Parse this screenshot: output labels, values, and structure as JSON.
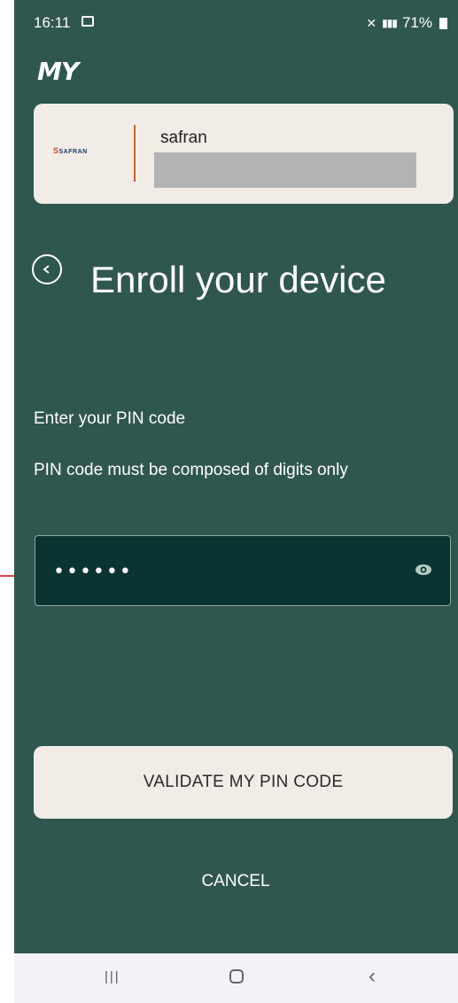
{
  "status_bar": {
    "time": "16:11",
    "battery": "71%"
  },
  "app": {
    "logo": "MY"
  },
  "org_card": {
    "org_logo_text": "SAFRAN",
    "org_name": "safran"
  },
  "page": {
    "title": "Enroll your device",
    "instruction": "Enter your PIN code",
    "hint": "PIN code must be composed of digits only"
  },
  "pin_field": {
    "value": "••••••"
  },
  "actions": {
    "validate_label": "VALIDATE MY PIN CODE",
    "cancel_label": "CANCEL"
  },
  "colors": {
    "background": "#305650",
    "card": "#f1ece6",
    "input_bg": "#0a3432",
    "annotation_arrow": "#cc0000"
  },
  "icons": {
    "back": "arrow-left-circle-icon",
    "visibility": "eye-icon",
    "nav_recent": "recent-apps-icon",
    "nav_home": "home-icon",
    "nav_back": "chevron-left-icon"
  }
}
